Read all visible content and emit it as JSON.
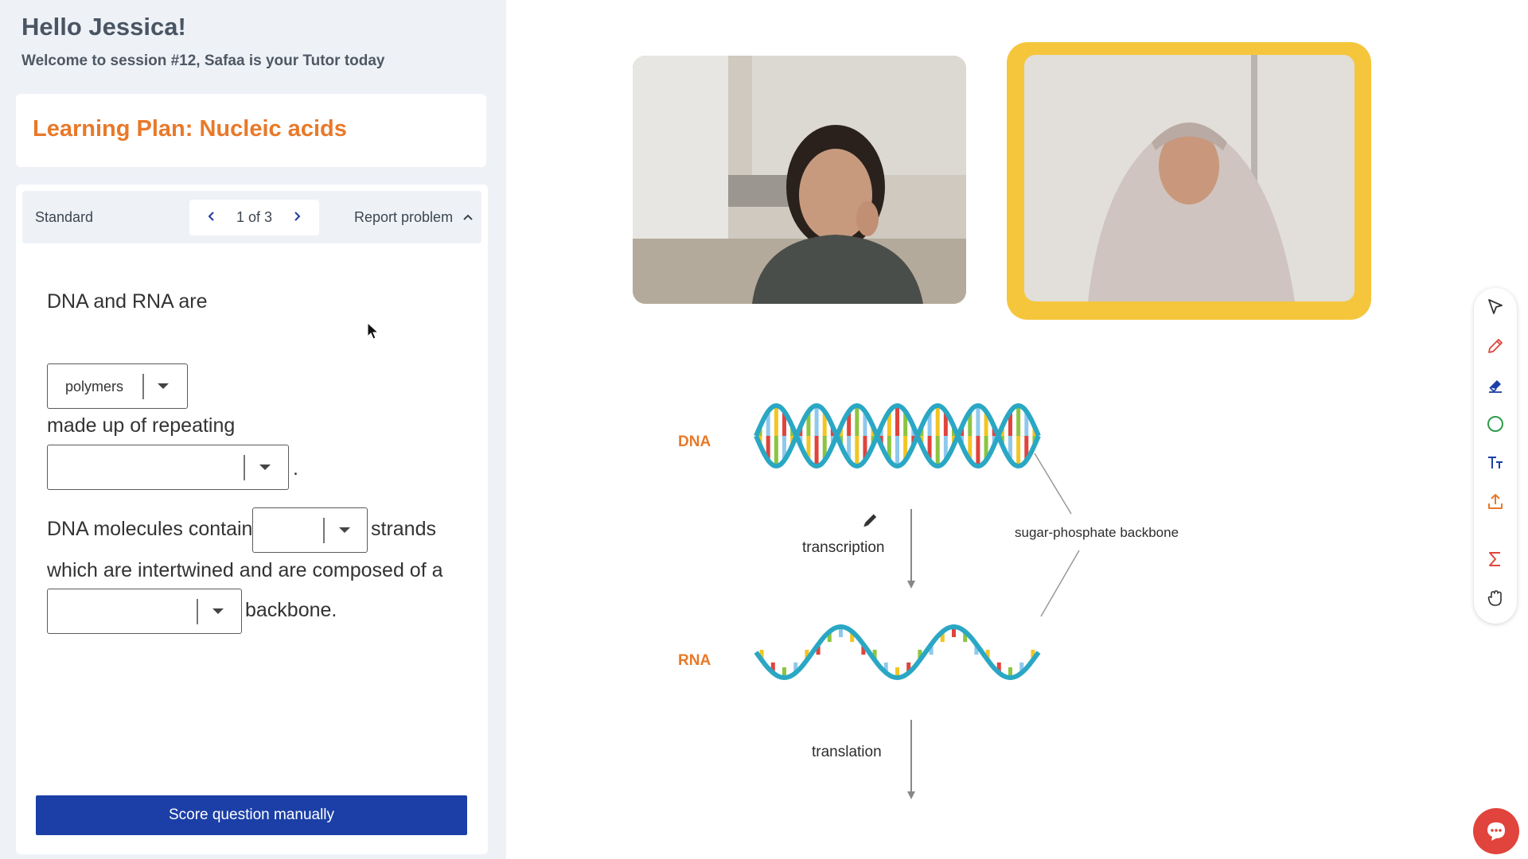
{
  "header": {
    "greeting": "Hello Jessica!",
    "welcome": "Welcome to session #12, Safaa is your Tutor today"
  },
  "plan": {
    "title": "Learning Plan: Nucleic acids"
  },
  "question": {
    "standard_label": "Standard",
    "pager_text": "1 of 3",
    "report_label": "Report problem",
    "line1": "DNA and RNA are",
    "dropdown1_value": "polymers",
    "line2": "made up of repeating",
    "dropdown2_value": "",
    "period": ".",
    "line3": "DNA molecules contain",
    "dropdown3_value": "",
    "line3b": "strands",
    "line4": "which are intertwined and are composed of a",
    "dropdown4_value": "",
    "line5": "backbone.",
    "score_button": "Score question manually"
  },
  "diagram": {
    "dna_label": "DNA",
    "rna_label": "RNA",
    "transcription_label": "transcription",
    "translation_label": "translation",
    "backbone_label": "sugar-phosphate backbone",
    "helix_color": "#2aa7c4",
    "base_colors": [
      "#f2c524",
      "#e0443c",
      "#8cc441",
      "#8fc8ec"
    ]
  },
  "colors": {
    "accent_orange": "#e8792a",
    "primary_blue": "#1b3fa6",
    "tutor_frame": "#f5c63c",
    "chat": "#e0443c"
  },
  "toolbar": {
    "tools": [
      "select-icon",
      "pencil-icon",
      "eraser-icon",
      "circle-icon",
      "text-icon",
      "upload-icon",
      "sigma-icon",
      "hand-icon"
    ]
  }
}
